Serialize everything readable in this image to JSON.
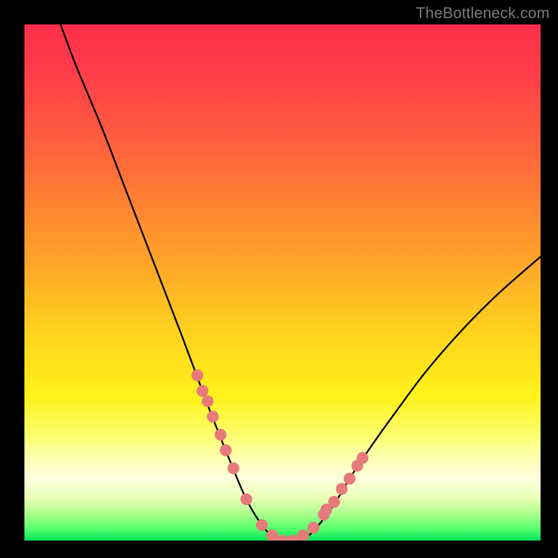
{
  "watermark": "TheBottleneck.com",
  "colors": {
    "background": "#000000",
    "gradient_top": "#ff2e4b",
    "gradient_mid": "#ffd31e",
    "gradient_bottom": "#00e05a",
    "curve": "#000000",
    "marker_fill": "#e77b7b",
    "marker_stroke": "#d06868"
  },
  "chart_data": {
    "type": "line",
    "title": "",
    "xlabel": "",
    "ylabel": "",
    "xlim": [
      0,
      100
    ],
    "ylim": [
      0,
      100
    ],
    "legend": false,
    "grid": false,
    "series": [
      {
        "name": "bottleneck-curve",
        "x": [
          7,
          10,
          15,
          20,
          25,
          30,
          33,
          36,
          40,
          43,
          46,
          48,
          50,
          52,
          55,
          57,
          60,
          63,
          67,
          72,
          78,
          85,
          92,
          100
        ],
        "y": [
          100,
          92,
          80,
          67,
          54,
          41,
          33,
          25,
          15,
          8,
          3,
          1,
          0,
          0,
          1,
          3,
          7,
          12,
          18,
          25,
          33,
          41,
          48,
          55
        ]
      }
    ],
    "markers": {
      "name": "highlighted-points",
      "x": [
        33.5,
        34.5,
        35.5,
        36.5,
        38,
        39,
        40.5,
        43,
        46,
        48,
        50,
        52,
        54,
        56,
        58,
        58.5,
        60,
        61.5,
        63,
        64.5,
        65.5
      ],
      "y": [
        32,
        29,
        27,
        24,
        20.5,
        17.5,
        14,
        8,
        3,
        1,
        0,
        0,
        1,
        2.5,
        5,
        6,
        7.5,
        10,
        12,
        14.5,
        16
      ]
    }
  }
}
